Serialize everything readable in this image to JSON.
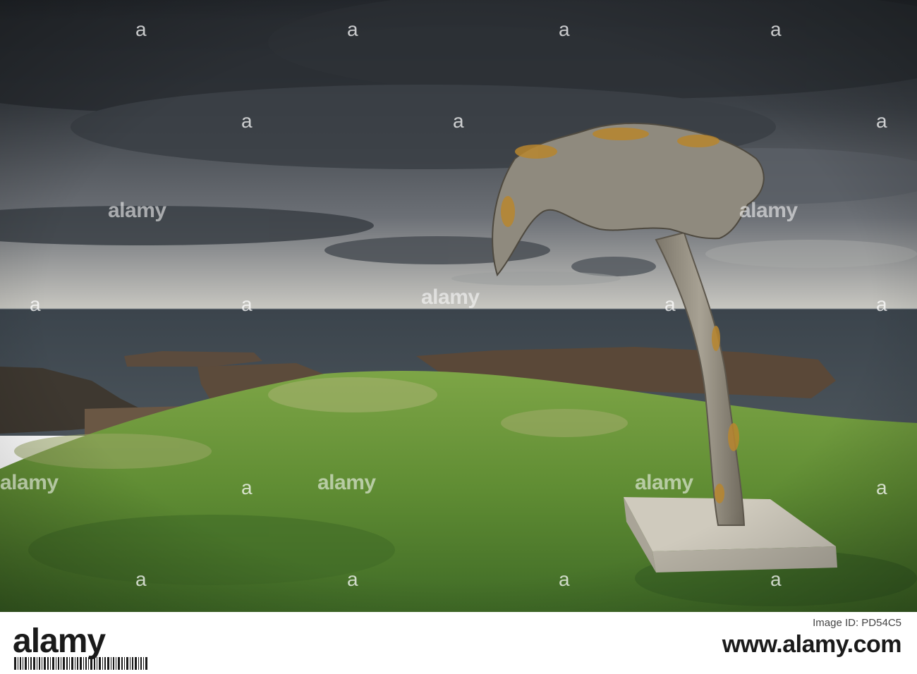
{
  "photo": {
    "subject": "whale-bone-sculpture",
    "palette": {
      "sky_dark": "#2f3338",
      "sky_mid": "#5b6168",
      "sky_light": "#c9c8c2",
      "sea": "#414a52",
      "rock": "#5a4a3c",
      "grass": "#6e9a3a",
      "bone": "#9a9486",
      "lichen": "#b8862e",
      "plinth": "#c9c4b8"
    }
  },
  "watermark": {
    "text": "alamy",
    "dot": "a"
  },
  "footer": {
    "brand": "alamy",
    "image_id_caption": "Image ID: PD54C5",
    "image_id": "www.alamy.com"
  }
}
